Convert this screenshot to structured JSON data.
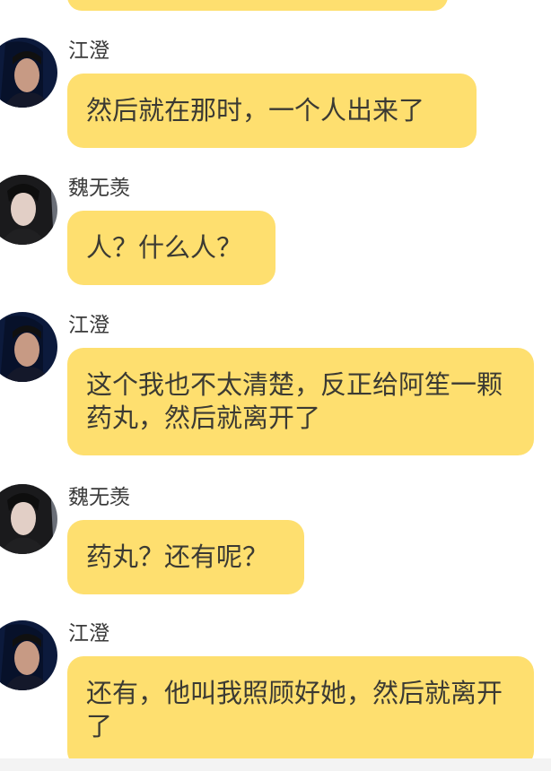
{
  "messages": [
    {
      "sender": "江澄",
      "text": "然后就在那时，一个人出来了"
    },
    {
      "sender": "魏无羡",
      "text": "人？什么人？"
    },
    {
      "sender": "江澄",
      "text": "这个我也不太清楚，反正给阿笙一颗药丸，然后就离开了"
    },
    {
      "sender": "魏无羡",
      "text": "药丸？还有呢？"
    },
    {
      "sender": "江澄",
      "text": "还有，他叫我照顾好她，然后就离开了"
    }
  ],
  "colors": {
    "bubble": "#fedf6f",
    "text": "#3b3a33",
    "background": "#ffffff"
  }
}
